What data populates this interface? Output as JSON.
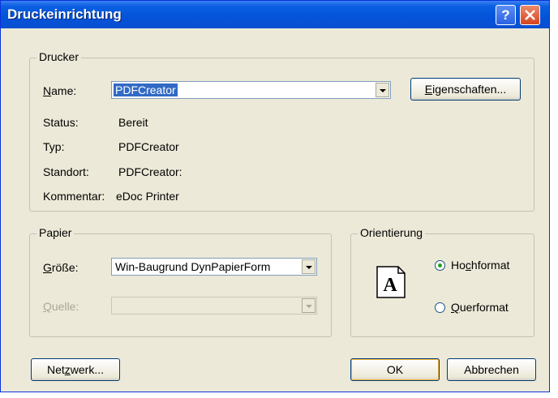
{
  "window": {
    "title": "Druckeinrichtung",
    "help_glyph": "?"
  },
  "printer": {
    "group_label": "Drucker",
    "name_label": "Name:",
    "name_value": "PDFCreator",
    "properties_button": "Eigenschaften...",
    "status_label": "Status:",
    "status_value": "Bereit",
    "type_label": "Typ:",
    "type_value": "PDFCreator",
    "location_label": "Standort:",
    "location_value": "PDFCreator:",
    "comment_label": "Kommentar:",
    "comment_value": "eDoc Printer"
  },
  "paper": {
    "group_label": "Papier",
    "size_label": "Größe:",
    "size_value": "Win-Baugrund DynPapierForm",
    "source_label": "Quelle:",
    "source_value": ""
  },
  "orientation": {
    "group_label": "Orientierung",
    "icon_letter": "A",
    "portrait_label": "Hochformat",
    "landscape_label": "Querformat",
    "selected": "portrait"
  },
  "buttons": {
    "network": "Netzwerk...",
    "ok": "OK",
    "cancel": "Abbrechen"
  }
}
